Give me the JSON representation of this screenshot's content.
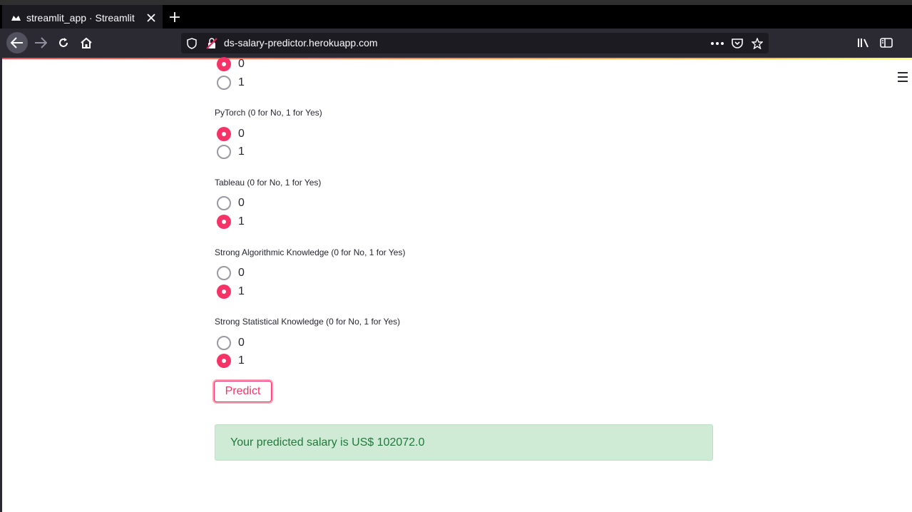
{
  "browser": {
    "tab_title": "streamlit_app · Streamlit",
    "url": "ds-salary-predictor.herokuapp.com"
  },
  "app": {
    "partial_group": {
      "options": [
        "0",
        "1"
      ],
      "selected": "0"
    },
    "questions": [
      {
        "label": "PyTorch (0 for No, 1 for Yes)",
        "options": [
          "0",
          "1"
        ],
        "selected": "0"
      },
      {
        "label": "Tableau (0 for No, 1 for Yes)",
        "options": [
          "0",
          "1"
        ],
        "selected": "1"
      },
      {
        "label": "Strong Algorithmic Knowledge (0 for No, 1 for Yes)",
        "options": [
          "0",
          "1"
        ],
        "selected": "1"
      },
      {
        "label": "Strong Statistical Knowledge (0 for No, 1 for Yes)",
        "options": [
          "0",
          "1"
        ],
        "selected": "1"
      }
    ],
    "predict_label": "Predict",
    "result_text": "Your predicted salary is US$ 102072.0"
  },
  "colors": {
    "accent": "#f63366",
    "success_bg": "#cfebd6",
    "success_text": "#1f7a3b"
  },
  "icons": [
    "streamlit-favicon-icon",
    "close-icon",
    "plus-icon",
    "back-arrow-icon",
    "forward-arrow-icon",
    "reload-icon",
    "home-icon",
    "shield-icon",
    "insecure-lock-icon",
    "more-icon",
    "pocket-icon",
    "star-icon",
    "library-icon",
    "sidebar-icon",
    "hamburger-menu-icon"
  ]
}
